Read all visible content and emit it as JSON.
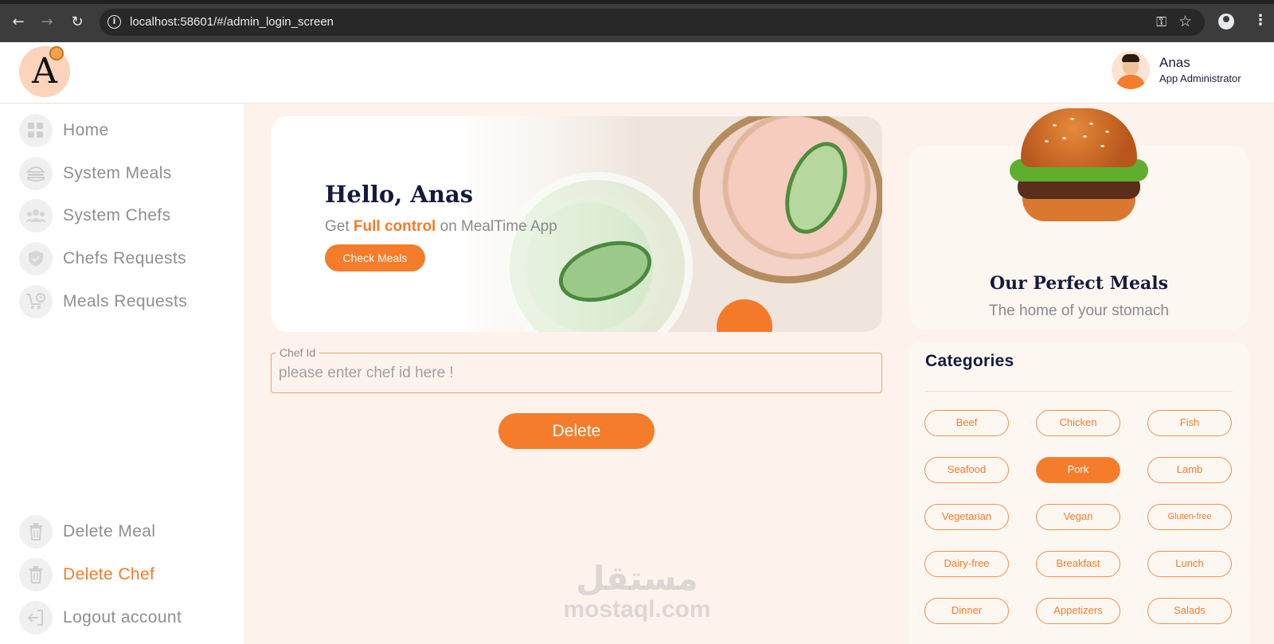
{
  "browser": {
    "url": "localhost:58601/#/admin_login_screen"
  },
  "header": {
    "logo_letter": "A",
    "user_name": "Anas",
    "user_role": "App Administrator"
  },
  "sidebar": {
    "items": [
      {
        "label": "Home",
        "icon": "grid-icon"
      },
      {
        "label": "System Meals",
        "icon": "burger-icon"
      },
      {
        "label": "System Chefs",
        "icon": "users-icon"
      },
      {
        "label": "Chefs Requests",
        "icon": "shield-icon"
      },
      {
        "label": "Meals Requests",
        "icon": "cart-clock-icon"
      }
    ],
    "bottom_items": [
      {
        "label": "Delete Meal",
        "icon": "trash-icon"
      },
      {
        "label": "Delete Chef",
        "icon": "trash-icon",
        "active": true
      },
      {
        "label": "Logout account",
        "icon": "logout-icon"
      }
    ]
  },
  "banner": {
    "greeting": "Hello, Anas",
    "sub_prefix": "Get ",
    "sub_highlight": "Full control",
    "sub_suffix": " on MealTime App",
    "button": "Check Meals"
  },
  "form": {
    "label": "Chef Id",
    "placeholder": "please enter chef id here !",
    "value": "",
    "submit": "Delete"
  },
  "meals_card": {
    "title": "Our Perfect Meals",
    "subtitle": "The home of your stomach"
  },
  "categories": {
    "title": "Categories",
    "items": [
      "Beef",
      "Chicken",
      "Fish",
      "Seafood",
      "Pork",
      "Lamb",
      "Vegetarian",
      "Vegan",
      "Gluten-free",
      "Dairy-free",
      "Breakfast",
      "Lunch",
      "Dinner",
      "Appetizers",
      "Salads"
    ],
    "selected": "Pork"
  },
  "watermark": {
    "arabic": "مستقل",
    "latin": "mostaql.com"
  },
  "colors": {
    "accent": "#f57c2a",
    "navy": "#141a3c",
    "background": "#fdf3ec"
  }
}
